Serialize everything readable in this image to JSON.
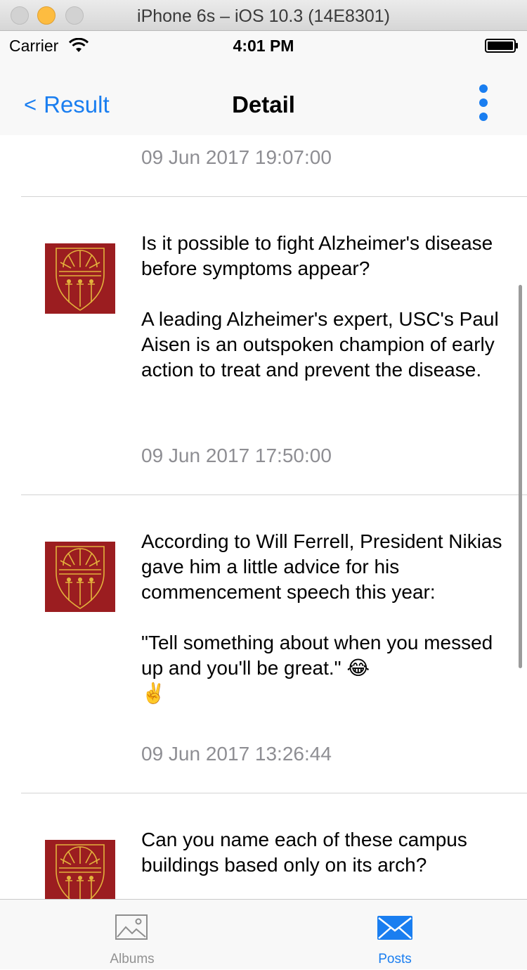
{
  "window": {
    "title": "iPhone 6s – iOS 10.3 (14E8301)"
  },
  "status_bar": {
    "carrier": "Carrier",
    "time": "4:01 PM"
  },
  "nav": {
    "back_label": "Result",
    "back_chevron": "<",
    "title": "Detail",
    "more_icon": "more-vertical-icon",
    "accent_color": "#1a7ef0"
  },
  "posts": [
    {
      "date": "09 Jun 2017 19:07:00"
    },
    {
      "text": "Is it possible to fight Alzheimer's disease before symptoms appear?\n\nA leading Alzheimer's expert, USC's Paul Aisen is an outspoken champion of early action to treat and prevent the disease.",
      "date": "09 Jun 2017 17:50:00"
    },
    {
      "text": "According to Will Ferrell, President Nikias gave him a little advice for his commencement speech this year:\n\n\"Tell something about when you messed up and you'll be great.\" 😂\n✌️",
      "date": "09 Jun 2017 13:26:44"
    },
    {
      "text": "Can you name each of these campus buildings based only on its arch?"
    }
  ],
  "avatar": {
    "background": "#9b1d20",
    "emblem_color": "#e3b23c"
  },
  "tabs": [
    {
      "label": "Albums",
      "icon": "photo-icon",
      "selected": false
    },
    {
      "label": "Posts",
      "icon": "mail-icon",
      "selected": true
    }
  ]
}
